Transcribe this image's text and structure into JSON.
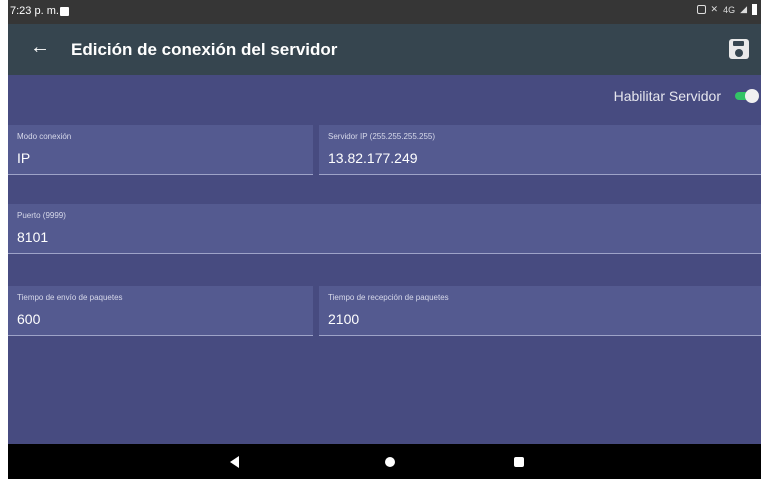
{
  "status_bar": {
    "time": "7:23 p. m.",
    "network": "4G"
  },
  "app_bar": {
    "title": "Edición de conexión del servidor"
  },
  "enable_server": {
    "label": "Habilitar Servidor",
    "enabled": true,
    "accent": "#33c466"
  },
  "fields": {
    "connection_mode": {
      "label": "Modo conexión",
      "value": "IP"
    },
    "server_ip": {
      "label": "Servidor IP (255.255.255.255)",
      "value": "13.82.177.249"
    },
    "port": {
      "label": "Puerto (9999)",
      "value": "8101"
    },
    "send_time": {
      "label": "Tiempo de envío de paquetes",
      "value": "600"
    },
    "receive_time": {
      "label": "Tiempo de recepción de paquetes",
      "value": "2100"
    }
  },
  "colors": {
    "background": "#474b80",
    "app_bar": "#36454f",
    "field": "#545a90",
    "status_bar": "#363636"
  },
  "icons": {
    "back": "arrow-left-icon",
    "save": "floppy-disk-icon",
    "nav_back": "triangle-back-icon",
    "nav_home": "circle-home-icon",
    "nav_recent": "square-recents-icon"
  }
}
